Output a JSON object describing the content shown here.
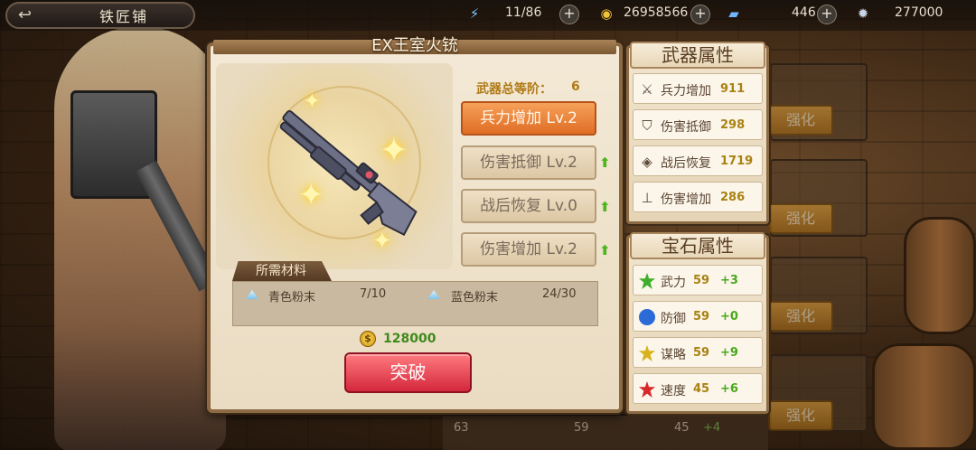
{
  "topbar": {
    "title": "铁匠铺",
    "resources": [
      {
        "icon": "lightning-icon",
        "value": "11/86"
      },
      {
        "icon": "gold-coin-icon",
        "value": "26958566"
      },
      {
        "icon": "gem-card-icon",
        "value": "446"
      },
      {
        "icon": "star-badge-icon",
        "value": "277000"
      }
    ]
  },
  "weapon": {
    "name": "EX王室火铳",
    "tier_label": "武器总等阶：",
    "tier_value": "6",
    "skills": [
      {
        "label": "兵力增加 Lv.2",
        "active": true
      },
      {
        "label": "伤害抵御 Lv.2",
        "active": false
      },
      {
        "label": "战后恢复 Lv.0",
        "active": false
      },
      {
        "label": "伤害增加 Lv.2",
        "active": false
      }
    ]
  },
  "materials": {
    "title": "所需材料",
    "items": [
      {
        "name": "青色粉末",
        "count": "7/10"
      },
      {
        "name": "蓝色粉末",
        "count": "24/30"
      }
    ],
    "cost": "128000",
    "action_label": "突破"
  },
  "weapon_attributes": {
    "title": "武器属性",
    "items": [
      {
        "icon": "sword-icon",
        "name": "兵力增加",
        "value": "911"
      },
      {
        "icon": "shield-icon",
        "name": "伤害抵御",
        "value": "298"
      },
      {
        "icon": "heal-icon",
        "name": "战后恢复",
        "value": "1719"
      },
      {
        "icon": "attack-up-icon",
        "name": "伤害增加",
        "value": "286"
      }
    ]
  },
  "gem_attributes": {
    "title": "宝石属性",
    "items": [
      {
        "name": "武力",
        "value": "59",
        "bonus": "+3",
        "color": "#3fae2a"
      },
      {
        "name": "防御",
        "value": "59",
        "bonus": "+0",
        "color": "#2a6bd8"
      },
      {
        "name": "谋略",
        "value": "59",
        "bonus": "+9",
        "color": "#d8b21a"
      },
      {
        "name": "速度",
        "value": "45",
        "bonus": "+6",
        "color": "#d8282a"
      }
    ]
  },
  "background": {
    "enhance_label": "强化",
    "bottom": {
      "level": "63",
      "stat_a": "59",
      "stat_b": "45",
      "stat_b_bonus": "+4"
    }
  }
}
